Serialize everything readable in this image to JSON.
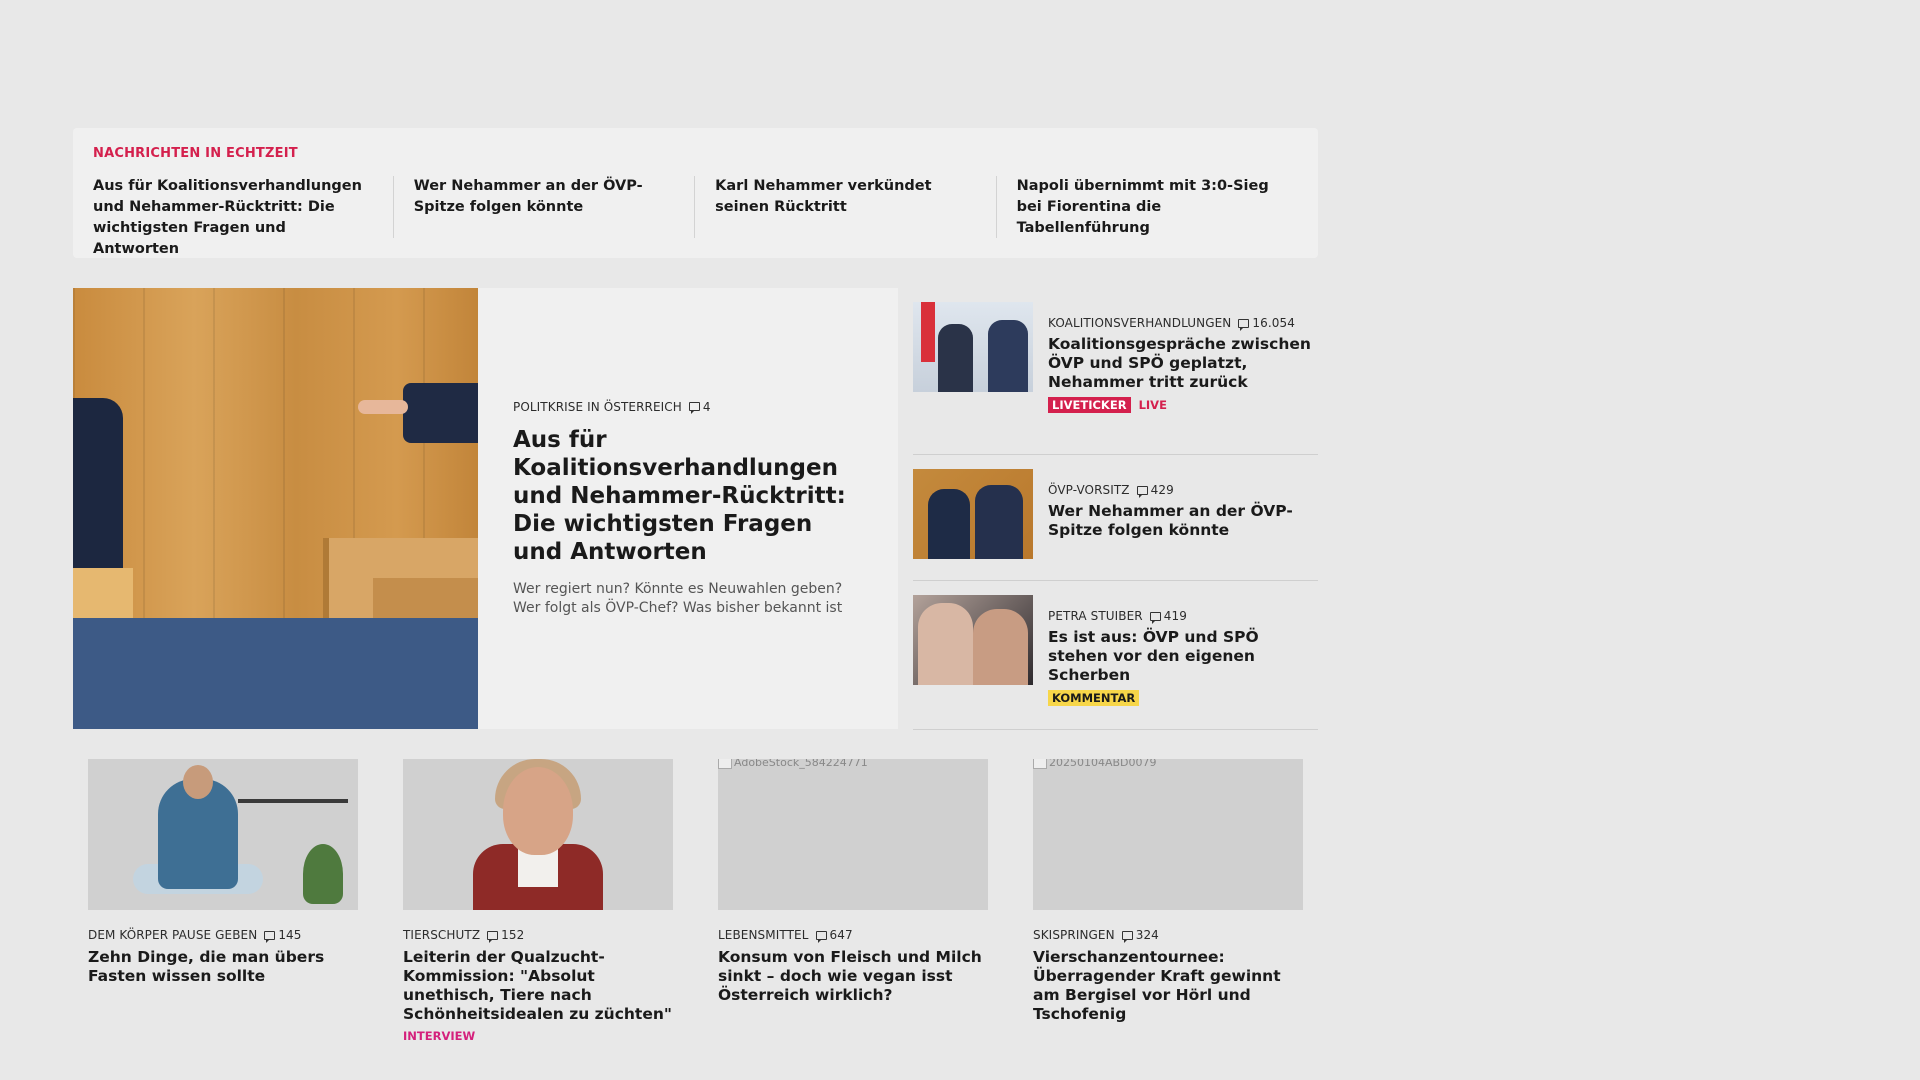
{
  "ticker": {
    "title": "NACHRICHTEN IN ECHTZEIT",
    "items": [
      "Aus für Koalitionsverhandlungen und Nehammer-Rücktritt: Die wichtigsten Fragen und Antworten",
      "Wer Nehammer an der ÖVP-Spitze folgen könnte",
      "Karl Nehammer verkündet seinen Rücktritt",
      "Napoli übernimmt mit 3:0-Sieg bei Fiorentina die Tabellenführung"
    ]
  },
  "hero": {
    "kicker": "POLITKRISE IN ÖSTERREICH",
    "comments": "4",
    "title": "Aus für Koalitionsverhandlun­gen und Nehammer-Rücktritt: Die wichtigsten Fragen und Antworten",
    "teaser": "Wer regiert nun? Könnte es Neuwahlen geben? Wer folgt als ÖVP-Chef? Was bisher bekannt ist"
  },
  "side": [
    {
      "kicker": "KOALITIONSVERHANDLUNGEN",
      "comments": "16.054",
      "title": "Koalitionsgespräche zwischen ÖVP und SPÖ geplatzt, Nehammer tritt zurück",
      "badge": "LIVETICKER",
      "live": "LIVE"
    },
    {
      "kicker": "ÖVP-VORSITZ",
      "comments": "429",
      "title": "Wer Nehammer an der ÖVP-Spitze folgen könnte"
    },
    {
      "kicker": "PETRA STUIBER",
      "comments": "419",
      "title": "Es ist aus: ÖVP und SPÖ stehen vor den eigenen Scherben",
      "badge": "KOMMENTAR"
    }
  ],
  "cards": [
    {
      "kicker": "DEM KÖRPER PAUSE GEBEN",
      "comments": "145",
      "title": "Zehn Dinge, die man übers Fasten wissen sollte"
    },
    {
      "kicker": "TIERSCHUTZ",
      "comments": "152",
      "title": "Leiterin der Qualzucht-Kommis­sion: \"Absolut unethisch, Tiere nach Schönheitsidealen zu züchten\"",
      "tag": "INTERVIEW"
    },
    {
      "kicker": "LEBENSMITTEL",
      "comments": "647",
      "title": "Konsum von Fleisch und Milch sinkt – doch wie vegan isst Österreich wirklich?",
      "img_alt": "AdobeStock_584224771"
    },
    {
      "kicker": "SKISPRINGEN",
      "comments": "324",
      "title": "Vierschanzentournee: Überragender Kraft gewinnt am Bergisel vor Hörl und Tschofenig",
      "img_alt": "20250104ABD0079"
    }
  ],
  "colors": {
    "accent_red": "#d4204d",
    "badge_yellow": "#f7d649",
    "interview_pink": "#d4207c",
    "background": "#e8e8e8"
  },
  "icons": {
    "comment": "comment-icon"
  }
}
